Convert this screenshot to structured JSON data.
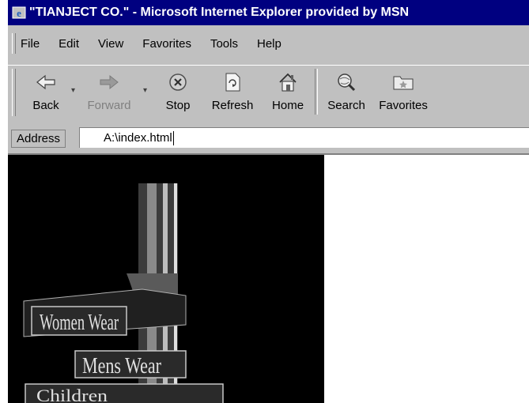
{
  "window": {
    "title": "\"TIANJECT CO.\" - Microsoft Internet Explorer provided by MSN"
  },
  "menu": [
    "File",
    "Edit",
    "View",
    "Favorites",
    "Tools",
    "Help"
  ],
  "toolbar": {
    "back": "Back",
    "forward": "Forward",
    "stop": "Stop",
    "refresh": "Refresh",
    "home": "Home",
    "search": "Search",
    "favorites": "Favorites"
  },
  "address": {
    "label": "Address",
    "value": "A:\\index.html"
  },
  "page": {
    "sign_labels": [
      "Women Wear",
      "Mens Wear",
      "Children"
    ]
  },
  "colors": {
    "titlebar": "#000080",
    "chrome": "#c0c0c0",
    "page_background": "#000000"
  }
}
